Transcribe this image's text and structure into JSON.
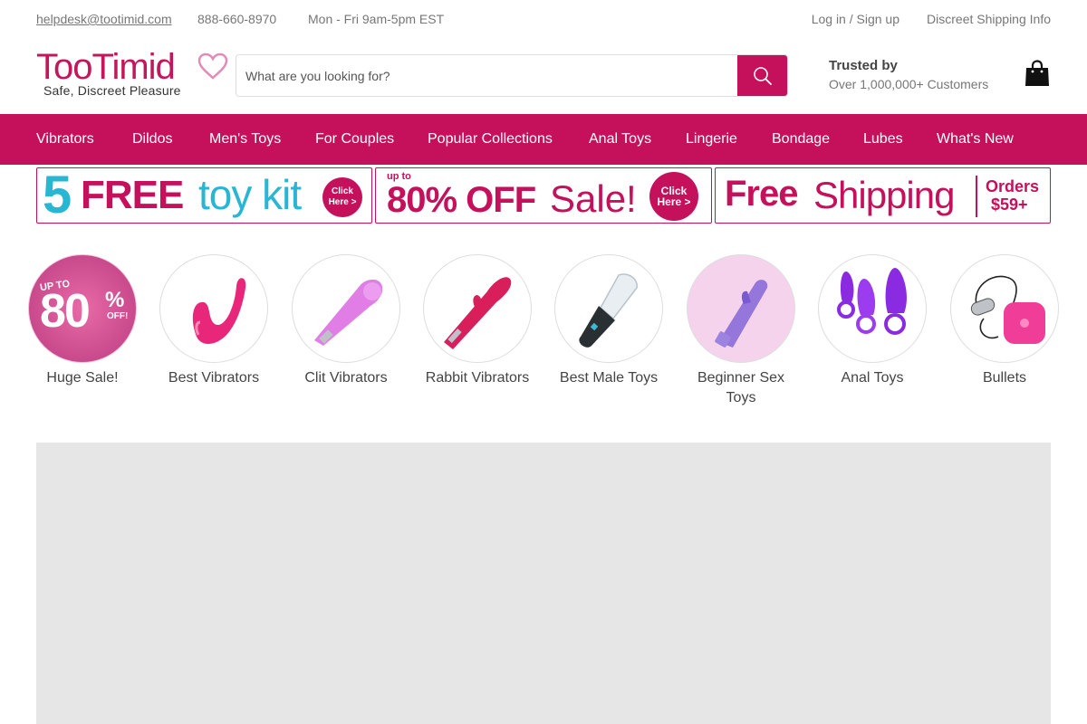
{
  "topbar": {
    "email": "helpdesk@tootimid.com",
    "phone": "888-660-8970",
    "hours": "Mon - Fri 9am-5pm EST",
    "login": "Log in / Sign up",
    "shipping_info": "Discreet Shipping Info"
  },
  "logo": {
    "name": "TooTimid",
    "tagline": "Safe, Discreet Pleasure"
  },
  "search": {
    "placeholder": "What are you looking for?"
  },
  "trust": {
    "title": "Trusted by",
    "subtitle": "Over 1,000,000+ Customers"
  },
  "icons": {
    "search": "search-icon",
    "cart": "shopping-bag-icon"
  },
  "nav": {
    "items": [
      "Vibrators",
      "Dildos",
      "Men's Toys",
      "For Couples",
      "Popular Collections",
      "Anal Toys",
      "Lingerie",
      "Bondage",
      "Lubes",
      "What's New"
    ]
  },
  "banners": {
    "kit": {
      "number": "5",
      "free": "FREE",
      "toy_kit": "toy kit",
      "cta": "Click Here >"
    },
    "sale": {
      "upto": "up to",
      "percent": "80% OFF",
      "sale": "Sale!",
      "cta": "Click Here >"
    },
    "shipping": {
      "free": "Free",
      "shipping": "Shipping",
      "orders": "Orders",
      "amount": "$59+"
    }
  },
  "sale_badge": {
    "upto": "UP TO",
    "number": "80",
    "percent": "%",
    "off": "OFF!"
  },
  "categories": [
    {
      "label": "Huge Sale!"
    },
    {
      "label": "Best Vibrators"
    },
    {
      "label": "Clit Vibrators"
    },
    {
      "label": "Rabbit Vibrators"
    },
    {
      "label": "Best Male Toys"
    },
    {
      "label": "Beginner Sex Toys"
    },
    {
      "label": "Anal Toys"
    },
    {
      "label": "Bullets"
    }
  ],
  "colors": {
    "brand": "#c5115b",
    "teal": "#29b6d3",
    "hero_placeholder": "#e6e6e6"
  }
}
